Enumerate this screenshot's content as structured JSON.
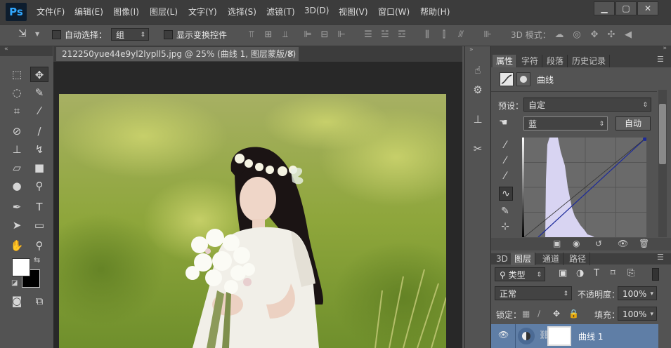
{
  "app": {
    "logo": "Ps"
  },
  "menu": [
    "文件(F)",
    "编辑(E)",
    "图像(I)",
    "图层(L)",
    "文字(Y)",
    "选择(S)",
    "滤镜(T)",
    "3D(D)",
    "视图(V)",
    "窗口(W)",
    "帮助(H)"
  ],
  "window_controls": {
    "minimize": "▁",
    "maximize": "▢",
    "close": "✕"
  },
  "options": {
    "auto_select_label": "自动选择：",
    "auto_select_value": "组",
    "show_transform_label": "显示变换控件",
    "mode_3d_label": "3D 模式："
  },
  "document": {
    "tab_title": "212250yue44e9yl2lypll5.jpg @ 25% (曲线 1, 图层蒙版/8) *",
    "close": "×"
  },
  "properties": {
    "tabs": [
      "属性",
      "字符",
      "段落",
      "历史记录"
    ],
    "panel_title": "曲线",
    "preset_label": "预设：",
    "preset_value": "自定",
    "channel_value": "蓝",
    "auto_button": "自动"
  },
  "layers": {
    "tabs": [
      "3D",
      "图层",
      "通道",
      "路径"
    ],
    "filter_value": "类型",
    "blend_mode": "正常",
    "opacity_label": "不透明度：",
    "opacity_value": "100%",
    "lock_label": "锁定：",
    "fill_label": "填充：",
    "fill_value": "100%",
    "layer_name": "曲线 1"
  },
  "colors": {
    "accent_layer_selected": "#5f7ea6",
    "curve_line": "#1c2a9a",
    "histogram": "#d8d4f2"
  }
}
